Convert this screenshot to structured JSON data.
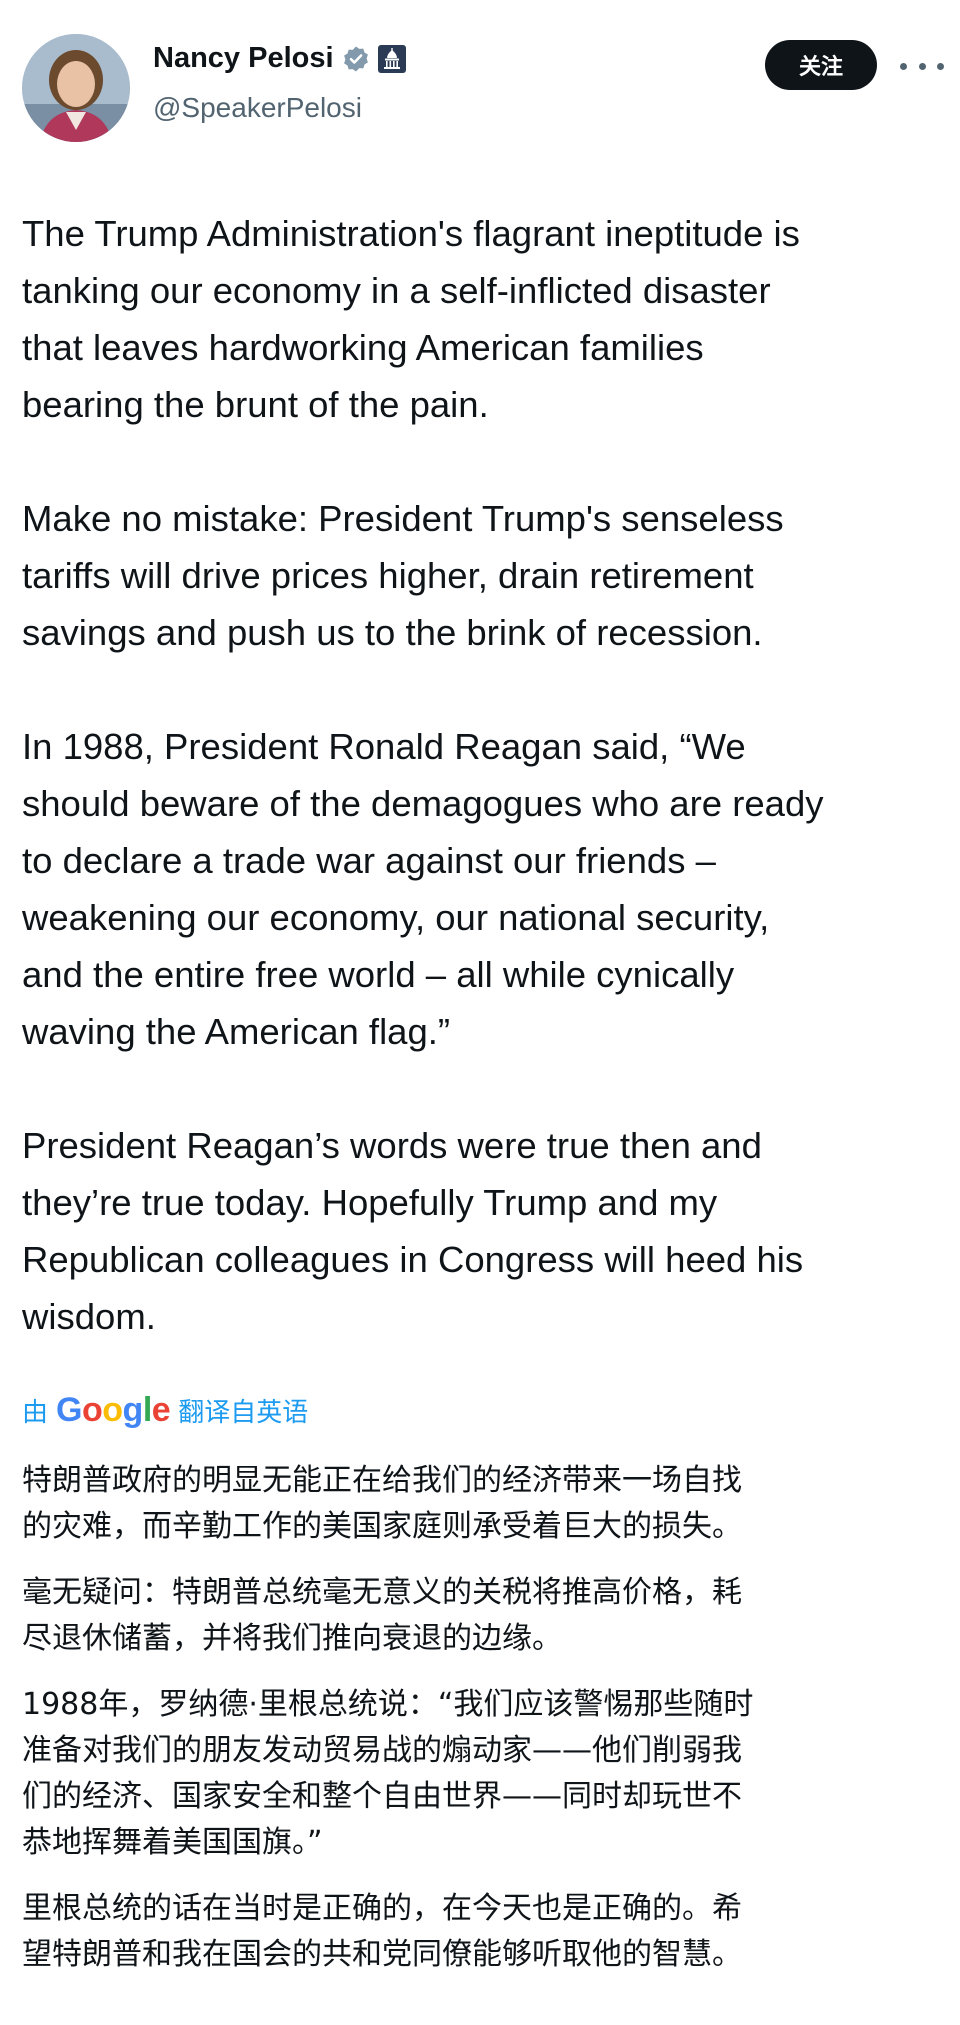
{
  "profile": {
    "display_name": "Nancy Pelosi",
    "handle": "@SpeakerPelosi",
    "verified_icon": "verified-badge-icon",
    "affiliation_icon": "capitol-building-icon"
  },
  "actions": {
    "follow_label": "关注",
    "more_icon": "more-dots-icon"
  },
  "tweet": {
    "paragraphs": [
      "The Trump Administration's flagrant ineptitude is\ntanking our economy in a self-inflicted disaster\nthat leaves hardworking American families\nbearing the brunt of the pain.",
      "Make no mistake: President Trump's senseless\ntariffs will drive prices higher, drain retirement\nsavings and push us to the brink of recession.",
      "In 1988, President Ronald Reagan said, “We\nshould beware of the demagogues who are ready\nto declare a trade war against our friends –\nweakening our economy, our national security,\nand the entire free world – all while cynically\nwaving the American flag.”",
      "President Reagan’s words were true then and\nthey’re true today. Hopefully Trump and my\nRepublican colleagues in Congress will heed his\nwisdom."
    ]
  },
  "translation": {
    "prefix": "由",
    "engine": "Google",
    "suffix": "翻译自英语",
    "paragraphs": [
      "特朗普政府的明显无能正在给我们的经济带来一场自找\n的灾难，而辛勤工作的美国家庭则承受着巨大的损失。",
      "毫无疑问：特朗普总统毫无意义的关税将推高价格，耗\n尽退休储蓄，并将我们推向衰退的边缘。",
      "1988年，罗纳德·里根总统说：“我们应该警惕那些随时\n准备对我们的朋友发动贸易战的煽动家——他们削弱我\n们的经济、国家安全和整个自由世界——同时却玩世不\n恭地挥舞着美国国旗。”",
      "里根总统的话在当时是正确的，在今天也是正确的。希\n望特朗普和我在国会的共和党同僚能够听取他的智慧。"
    ]
  },
  "colors": {
    "text": "#0f1419",
    "secondary": "#536471",
    "link": "#1d9bf0",
    "button_bg": "#0f1419"
  }
}
